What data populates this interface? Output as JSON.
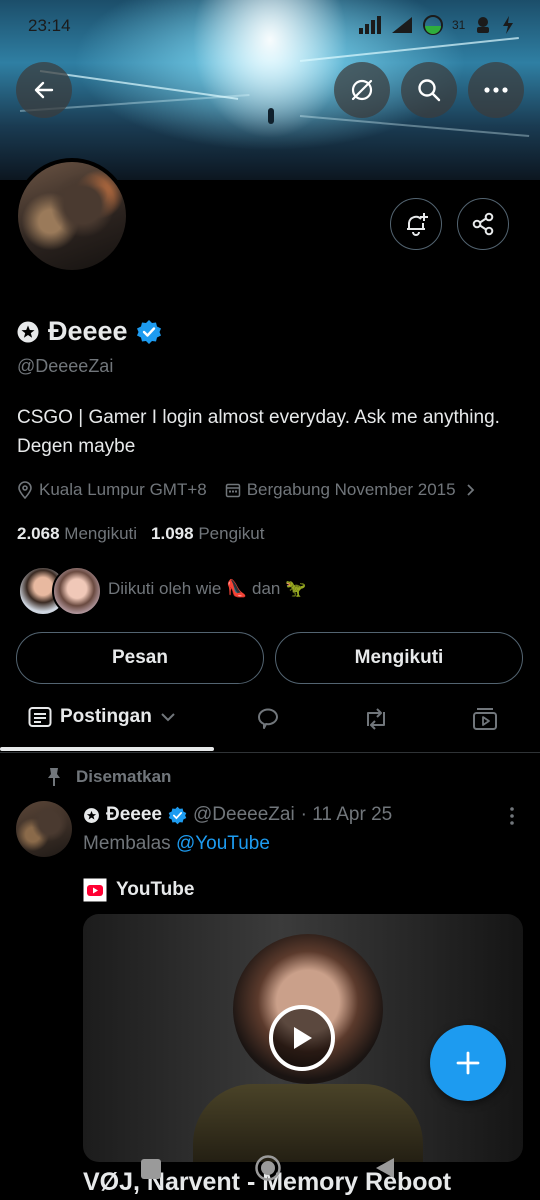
{
  "status_bar": {
    "time": "23:14",
    "battery_level": "31"
  },
  "profile": {
    "display_name": "Đeeee",
    "handle": "@DeeeeZai",
    "bio": "CSGO | Gamer I login almost everyday. Ask me anything. Degen maybe",
    "location": "Kuala Lumpur GMT+8",
    "joined": "Bergabung November 2015",
    "following_count": "2.068",
    "following_label": "Mengikuti",
    "followers_count": "1.098",
    "followers_label": "Pengikut",
    "followed_by": "Diikuti oleh wie 👠 dan 🦖"
  },
  "actions": {
    "message_label": "Pesan",
    "following_button_label": "Mengikuti"
  },
  "tabs": {
    "active_label": "Postingan"
  },
  "pinned_post": {
    "pinned_label": "Disematkan",
    "author_name": "Đeeee",
    "author_handle": "@DeeeeZai",
    "date": "· 11 Apr 25",
    "reply_prefix": "Membalas",
    "reply_to": "@YouTube",
    "card_source": "YouTube",
    "card_title": "VØJ, Narvent - Memory Reboot"
  },
  "icons": {
    "back": "arrow-left-icon",
    "grok": "slash-circle-icon",
    "search": "search-icon",
    "more": "more-horizontal-icon",
    "notify": "bell-plus-icon",
    "share": "share-icon",
    "verified": "verified-badge-icon",
    "location": "location-pin-icon",
    "calendar": "calendar-icon",
    "pin": "pin-icon",
    "compose": "plus-icon"
  },
  "colors": {
    "accent": "#1d9bf0",
    "text": "#e7e9ea",
    "muted": "#71767b",
    "border": "#536471",
    "youtube": "#ff0033"
  }
}
